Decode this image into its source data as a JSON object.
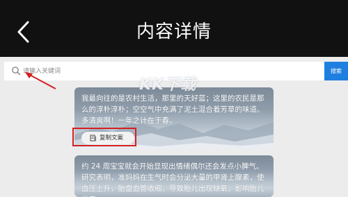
{
  "header": {
    "title": "内容详情",
    "back_icon": "chevron-left-icon"
  },
  "search": {
    "placeholder": "请输入关键词",
    "button_label": "搜索",
    "icon": "search-icon"
  },
  "watermark": "KK下载",
  "cards": [
    {
      "text": "我最向往的是农村生活，那里的天好蓝；这里的农民是那么的淳朴淳朴；空空气中充满了泥土混合着芳草的味道。多清爽啊！一年之计在于春。",
      "copy_label": "复制文案",
      "copy_icon": "document-copy-icon"
    },
    {
      "text": "约 24 周宝宝就会开始显现出情绪偶尔还会发点小脾气。研究表明，准妈妈在生气时会分泌大量的甲肾上腺素，使血压上升，胎盘血管收缩，导致胎儿出现缺氧，影响胎儿发育。"
    }
  ],
  "colors": {
    "header_bg": "#111111",
    "search_button": "#1f7fe0",
    "annotation": "#d42020"
  }
}
